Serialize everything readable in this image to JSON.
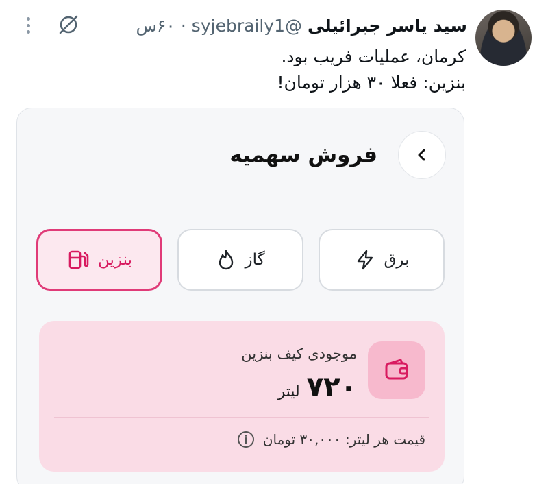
{
  "tweet": {
    "display_name": "سید یاسر جبرائیلی",
    "handle": "@syjebraily1",
    "separator": "·",
    "time": "۶۰س",
    "lines": [
      "کرمان، عملیات فریب بود.",
      "بنزین: فعلا ۳۰ هزار تومان!"
    ]
  },
  "icons": {
    "more": "more-dots-icon",
    "grok": "grok-icon",
    "back": "chevron-right-icon",
    "electric": "lightning-icon",
    "gas": "flame-icon",
    "fuel": "fuel-pump-icon",
    "wallet": "wallet-icon",
    "info": "info-icon"
  },
  "card": {
    "title": "فروش سهمیه",
    "tabs": [
      {
        "label": "برق",
        "active": false
      },
      {
        "label": "گاز",
        "active": false
      },
      {
        "label": "بنزین",
        "active": true
      }
    ],
    "balance": {
      "label": "موجودی کیف بنزین",
      "amount": "۷۲۰",
      "unit": "لیتر",
      "price_text": "قیمت هر لیتر: ۳۰,۰۰۰ تومان"
    }
  },
  "colors": {
    "accent": "#d81b60",
    "accent_bg": "#fce8ef",
    "balance_bg": "#fadce6",
    "wallet_tile": "#f7b9cd"
  }
}
